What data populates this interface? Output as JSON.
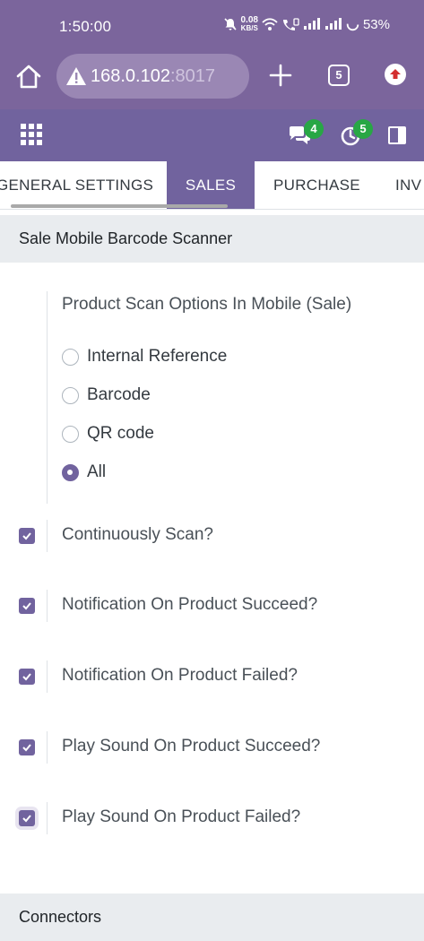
{
  "status_bar": {
    "time": "1:50:00",
    "net_speed_value": "0.08",
    "net_speed_unit": "KB/S",
    "battery": "53%"
  },
  "browser": {
    "url_host": "168.0.102",
    "url_port": ":8017",
    "tab_count": "5"
  },
  "app_bar": {
    "messages_count": "4",
    "activities_count": "5"
  },
  "tabs": [
    {
      "label": "GENERAL SETTINGS",
      "active": false
    },
    {
      "label": "SALES",
      "active": true
    },
    {
      "label": "PURCHASE",
      "active": false
    },
    {
      "label": "INV",
      "active": false
    }
  ],
  "section": {
    "title": "Sale Mobile Barcode Scanner",
    "scan_options": {
      "title": "Product Scan Options In Mobile (Sale)",
      "options": [
        {
          "label": "Internal Reference",
          "checked": false
        },
        {
          "label": "Barcode",
          "checked": false
        },
        {
          "label": "QR code",
          "checked": false
        },
        {
          "label": "All",
          "checked": true
        }
      ]
    },
    "toggles": [
      {
        "label": "Continuously Scan?",
        "checked": true
      },
      {
        "label": "Notification On Product Succeed?",
        "checked": true
      },
      {
        "label": "Notification On Product Failed?",
        "checked": true
      },
      {
        "label": "Play Sound On Product Succeed?",
        "checked": true
      },
      {
        "label": "Play Sound On Product Failed?",
        "checked": true
      }
    ]
  },
  "next_section": {
    "title": "Connectors"
  },
  "colors": {
    "brand": "#71639e",
    "browser_chrome": "#7b659c",
    "badge": "#28a745"
  }
}
